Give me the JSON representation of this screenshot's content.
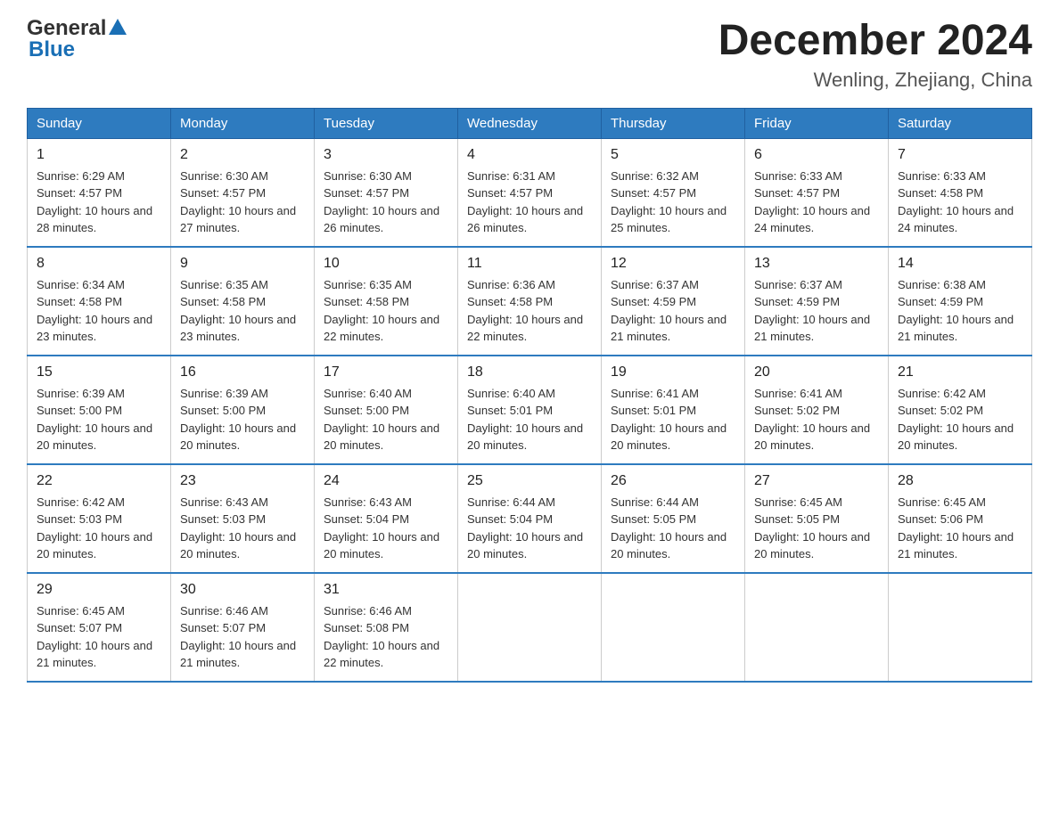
{
  "header": {
    "logo_line1": "General",
    "logo_line2": "Blue",
    "month_title": "December 2024",
    "location": "Wenling, Zhejiang, China"
  },
  "days_of_week": [
    "Sunday",
    "Monday",
    "Tuesday",
    "Wednesday",
    "Thursday",
    "Friday",
    "Saturday"
  ],
  "weeks": [
    [
      {
        "day": "1",
        "sunrise": "6:29 AM",
        "sunset": "4:57 PM",
        "daylight": "10 hours and 28 minutes."
      },
      {
        "day": "2",
        "sunrise": "6:30 AM",
        "sunset": "4:57 PM",
        "daylight": "10 hours and 27 minutes."
      },
      {
        "day": "3",
        "sunrise": "6:30 AM",
        "sunset": "4:57 PM",
        "daylight": "10 hours and 26 minutes."
      },
      {
        "day": "4",
        "sunrise": "6:31 AM",
        "sunset": "4:57 PM",
        "daylight": "10 hours and 26 minutes."
      },
      {
        "day": "5",
        "sunrise": "6:32 AM",
        "sunset": "4:57 PM",
        "daylight": "10 hours and 25 minutes."
      },
      {
        "day": "6",
        "sunrise": "6:33 AM",
        "sunset": "4:57 PM",
        "daylight": "10 hours and 24 minutes."
      },
      {
        "day": "7",
        "sunrise": "6:33 AM",
        "sunset": "4:58 PM",
        "daylight": "10 hours and 24 minutes."
      }
    ],
    [
      {
        "day": "8",
        "sunrise": "6:34 AM",
        "sunset": "4:58 PM",
        "daylight": "10 hours and 23 minutes."
      },
      {
        "day": "9",
        "sunrise": "6:35 AM",
        "sunset": "4:58 PM",
        "daylight": "10 hours and 23 minutes."
      },
      {
        "day": "10",
        "sunrise": "6:35 AM",
        "sunset": "4:58 PM",
        "daylight": "10 hours and 22 minutes."
      },
      {
        "day": "11",
        "sunrise": "6:36 AM",
        "sunset": "4:58 PM",
        "daylight": "10 hours and 22 minutes."
      },
      {
        "day": "12",
        "sunrise": "6:37 AM",
        "sunset": "4:59 PM",
        "daylight": "10 hours and 21 minutes."
      },
      {
        "day": "13",
        "sunrise": "6:37 AM",
        "sunset": "4:59 PM",
        "daylight": "10 hours and 21 minutes."
      },
      {
        "day": "14",
        "sunrise": "6:38 AM",
        "sunset": "4:59 PM",
        "daylight": "10 hours and 21 minutes."
      }
    ],
    [
      {
        "day": "15",
        "sunrise": "6:39 AM",
        "sunset": "5:00 PM",
        "daylight": "10 hours and 20 minutes."
      },
      {
        "day": "16",
        "sunrise": "6:39 AM",
        "sunset": "5:00 PM",
        "daylight": "10 hours and 20 minutes."
      },
      {
        "day": "17",
        "sunrise": "6:40 AM",
        "sunset": "5:00 PM",
        "daylight": "10 hours and 20 minutes."
      },
      {
        "day": "18",
        "sunrise": "6:40 AM",
        "sunset": "5:01 PM",
        "daylight": "10 hours and 20 minutes."
      },
      {
        "day": "19",
        "sunrise": "6:41 AM",
        "sunset": "5:01 PM",
        "daylight": "10 hours and 20 minutes."
      },
      {
        "day": "20",
        "sunrise": "6:41 AM",
        "sunset": "5:02 PM",
        "daylight": "10 hours and 20 minutes."
      },
      {
        "day": "21",
        "sunrise": "6:42 AM",
        "sunset": "5:02 PM",
        "daylight": "10 hours and 20 minutes."
      }
    ],
    [
      {
        "day": "22",
        "sunrise": "6:42 AM",
        "sunset": "5:03 PM",
        "daylight": "10 hours and 20 minutes."
      },
      {
        "day": "23",
        "sunrise": "6:43 AM",
        "sunset": "5:03 PM",
        "daylight": "10 hours and 20 minutes."
      },
      {
        "day": "24",
        "sunrise": "6:43 AM",
        "sunset": "5:04 PM",
        "daylight": "10 hours and 20 minutes."
      },
      {
        "day": "25",
        "sunrise": "6:44 AM",
        "sunset": "5:04 PM",
        "daylight": "10 hours and 20 minutes."
      },
      {
        "day": "26",
        "sunrise": "6:44 AM",
        "sunset": "5:05 PM",
        "daylight": "10 hours and 20 minutes."
      },
      {
        "day": "27",
        "sunrise": "6:45 AM",
        "sunset": "5:05 PM",
        "daylight": "10 hours and 20 minutes."
      },
      {
        "day": "28",
        "sunrise": "6:45 AM",
        "sunset": "5:06 PM",
        "daylight": "10 hours and 21 minutes."
      }
    ],
    [
      {
        "day": "29",
        "sunrise": "6:45 AM",
        "sunset": "5:07 PM",
        "daylight": "10 hours and 21 minutes."
      },
      {
        "day": "30",
        "sunrise": "6:46 AM",
        "sunset": "5:07 PM",
        "daylight": "10 hours and 21 minutes."
      },
      {
        "day": "31",
        "sunrise": "6:46 AM",
        "sunset": "5:08 PM",
        "daylight": "10 hours and 22 minutes."
      },
      null,
      null,
      null,
      null
    ]
  ],
  "labels": {
    "sunrise": "Sunrise:",
    "sunset": "Sunset:",
    "daylight": "Daylight:"
  }
}
